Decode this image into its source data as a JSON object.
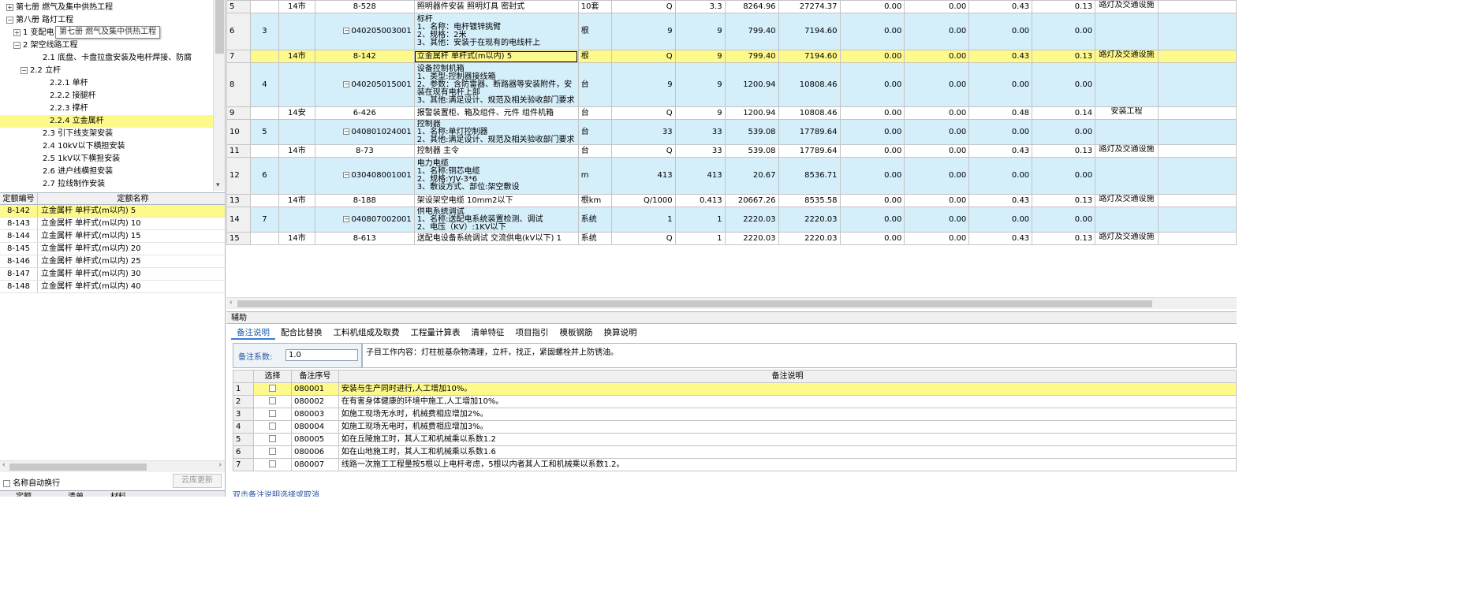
{
  "tree": {
    "items": [
      {
        "label": "第七册 燃气及集中供热工程",
        "toggle": "⊞"
      },
      {
        "label": "第八册 路灯工程",
        "toggle": "⊟"
      },
      {
        "label": "1 变配电",
        "toggle": "⊞"
      },
      {
        "label": "2 架空线路工程",
        "toggle": "⊟"
      },
      {
        "label": "2.1 底盘、卡盘拉盘安装及电杆焊接、防腐",
        "toggle": ""
      },
      {
        "label": "2.2 立杆",
        "toggle": "⊟"
      },
      {
        "label": "2.2.1 单杆",
        "toggle": ""
      },
      {
        "label": "2.2.2 接腿杆",
        "toggle": ""
      },
      {
        "label": "2.2.3 撑杆",
        "toggle": ""
      },
      {
        "label": "2.2.4 立金属杆",
        "toggle": ""
      },
      {
        "label": "2.3 引下线支架安装",
        "toggle": ""
      },
      {
        "label": "2.4 10kV以下横担安装",
        "toggle": ""
      },
      {
        "label": "2.5 1kV以下横担安装",
        "toggle": ""
      },
      {
        "label": "2.6 进户线横担安装",
        "toggle": ""
      },
      {
        "label": "2.7 拉线制作安装",
        "toggle": ""
      }
    ],
    "tooltip": "第七册 燃气及集中供热工程"
  },
  "quota_list": {
    "headers": [
      "定额编号",
      "定额名称"
    ],
    "rows": [
      [
        "8-142",
        "立金属杆 单杆式(m以内) 5"
      ],
      [
        "8-143",
        "立金属杆 单杆式(m以内) 10"
      ],
      [
        "8-144",
        "立金属杆 单杆式(m以内) 15"
      ],
      [
        "8-145",
        "立金属杆 单杆式(m以内) 20"
      ],
      [
        "8-146",
        "立金属杆 单杆式(m以内) 25"
      ],
      [
        "8-147",
        "立金属杆 单杆式(m以内) 30"
      ],
      [
        "8-148",
        "立金属杆 单杆式(m以内) 40"
      ]
    ]
  },
  "left_bottom": {
    "auto_wrap_label": "名称自动换行",
    "cloud_update_label": "云库更新",
    "tabs": [
      "定额",
      "清单",
      "材料"
    ]
  },
  "main_grid": {
    "rows": [
      {
        "rn": "5",
        "seq": "",
        "type": "14市",
        "code": "8-528",
        "name": "照明器件安装 照明灯具 密封式",
        "unit": "10套",
        "expr": "Q",
        "qty": "3.3",
        "price": "8264.96",
        "total": "27274.37",
        "c1": "0.00",
        "c2": "0.00",
        "c3": "0.43",
        "c4": "0.13",
        "cat": "路灯及交通设施",
        "style": "white"
      },
      {
        "rn": "6",
        "seq": "3",
        "type": "",
        "code": "040205003001",
        "name": "标杆\n1、名称：电杆镀锌挑臂\n2、规格：2米\n3、其他：安装于在现有的电线杆上",
        "unit": "根",
        "expr": "9",
        "qty": "9",
        "price": "799.40",
        "total": "7194.60",
        "c1": "0.00",
        "c2": "0.00",
        "c3": "0.00",
        "c4": "0.00",
        "cat": "",
        "style": "blue"
      },
      {
        "rn": "7",
        "seq": "",
        "type": "14市",
        "code": "8-142",
        "name": "立金属杆 单杆式(m以内) 5",
        "unit": "根",
        "expr": "Q",
        "qty": "9",
        "price": "799.40",
        "total": "7194.60",
        "c1": "0.00",
        "c2": "0.00",
        "c3": "0.43",
        "c4": "0.13",
        "cat": "路灯及交通设施",
        "style": "yel"
      },
      {
        "rn": "8",
        "seq": "4",
        "type": "",
        "code": "040205015001",
        "name": "设备控制机箱\n1、类型:控制器接线箱\n2、参数：含防雷器、断路器等安装附件，安装在现有电杆上部\n3、其他:满足设计、规范及相关验收部门要求",
        "unit": "台",
        "expr": "9",
        "qty": "9",
        "price": "1200.94",
        "total": "10808.46",
        "c1": "0.00",
        "c2": "0.00",
        "c3": "0.00",
        "c4": "0.00",
        "cat": "",
        "style": "blue"
      },
      {
        "rn": "9",
        "seq": "",
        "type": "14安",
        "code": "6-426",
        "name": "报警装置柜、箱及组件、元件 组件机箱",
        "unit": "台",
        "expr": "Q",
        "qty": "9",
        "price": "1200.94",
        "total": "10808.46",
        "c1": "0.00",
        "c2": "0.00",
        "c3": "0.48",
        "c4": "0.14",
        "cat": "安装工程",
        "style": "white"
      },
      {
        "rn": "10",
        "seq": "5",
        "type": "",
        "code": "040801024001",
        "name": "控制器\n1、名称:单灯控制器\n2、其他:满足设计、规范及相关验收部门要求",
        "unit": "台",
        "expr": "33",
        "qty": "33",
        "price": "539.08",
        "total": "17789.64",
        "c1": "0.00",
        "c2": "0.00",
        "c3": "0.00",
        "c4": "0.00",
        "cat": "",
        "style": "blue"
      },
      {
        "rn": "11",
        "seq": "",
        "type": "14市",
        "code": "8-73",
        "name": "控制器 主令",
        "unit": "台",
        "expr": "Q",
        "qty": "33",
        "price": "539.08",
        "total": "17789.64",
        "c1": "0.00",
        "c2": "0.00",
        "c3": "0.43",
        "c4": "0.13",
        "cat": "路灯及交通设施",
        "style": "white"
      },
      {
        "rn": "12",
        "seq": "6",
        "type": "",
        "code": "030408001001",
        "name": "电力电缆\n1、名称:铜芯电缆\n2、规格:YJV-3*6\n3、敷设方式、部位:架空敷设",
        "unit": "m",
        "expr": "413",
        "qty": "413",
        "price": "20.67",
        "total": "8536.71",
        "c1": "0.00",
        "c2": "0.00",
        "c3": "0.00",
        "c4": "0.00",
        "cat": "",
        "style": "blue"
      },
      {
        "rn": "13",
        "seq": "",
        "type": "14市",
        "code": "8-188",
        "name": "架设架空电缆 10mm2以下",
        "unit": "根km",
        "expr": "Q/1000",
        "qty": "0.413",
        "price": "20667.26",
        "total": "8535.58",
        "c1": "0.00",
        "c2": "0.00",
        "c3": "0.43",
        "c4": "0.13",
        "cat": "路灯及交通设施",
        "style": "white"
      },
      {
        "rn": "14",
        "seq": "7",
        "type": "",
        "code": "040807002001",
        "name": "供电系统调试\n1、名称:送配电系统装置检测、调试\n2、电压（KV）:1KV以下",
        "unit": "系统",
        "expr": "1",
        "qty": "1",
        "price": "2220.03",
        "total": "2220.03",
        "c1": "0.00",
        "c2": "0.00",
        "c3": "0.00",
        "c4": "0.00",
        "cat": "",
        "style": "blue"
      },
      {
        "rn": "15",
        "seq": "",
        "type": "14市",
        "code": "8-613",
        "name": "送配电设备系统调试 交流供电(kV以下) 1",
        "unit": "系统",
        "expr": "Q",
        "qty": "1",
        "price": "2220.03",
        "total": "2220.03",
        "c1": "0.00",
        "c2": "0.00",
        "c3": "0.43",
        "c4": "0.13",
        "cat": "路灯及交通设施",
        "style": "white"
      }
    ]
  },
  "aux": {
    "title": "辅助",
    "tabs": [
      "备注说明",
      "配合比替换",
      "工料机组成及取费",
      "工程量计算表",
      "清单特征",
      "项目指引",
      "模板钢筋",
      "换算说明"
    ],
    "coef_label": "备注系数:",
    "coef_value": "1.0",
    "work_content": "子目工作内容：灯柱桩基杂物清理，立杆，找正，紧固螺栓并上防锈油。"
  },
  "notes": {
    "headers": [
      "",
      "选择",
      "备注序号",
      "备注说明"
    ],
    "rows": [
      [
        "1",
        "080001",
        "安装与生产同时进行,人工增加10%。"
      ],
      [
        "2",
        "080002",
        "在有害身体健康的环境中施工,人工增加10%。"
      ],
      [
        "3",
        "080003",
        "如施工现场无水时，机械费相应增加2%。"
      ],
      [
        "4",
        "080004",
        "如施工现场无电时，机械费相应增加3%。"
      ],
      [
        "5",
        "080005",
        "如在丘陵施工时，其人工和机械乘以系数1.2"
      ],
      [
        "6",
        "080006",
        "如在山地施工时，其人工和机械乘以系数1.6"
      ],
      [
        "7",
        "080007",
        "线路一次施工工程量按5根以上电杆考虑，5根以内者其人工和机械乘以系数1.2。"
      ]
    ],
    "hint": "双击备注说明选择或取消"
  }
}
